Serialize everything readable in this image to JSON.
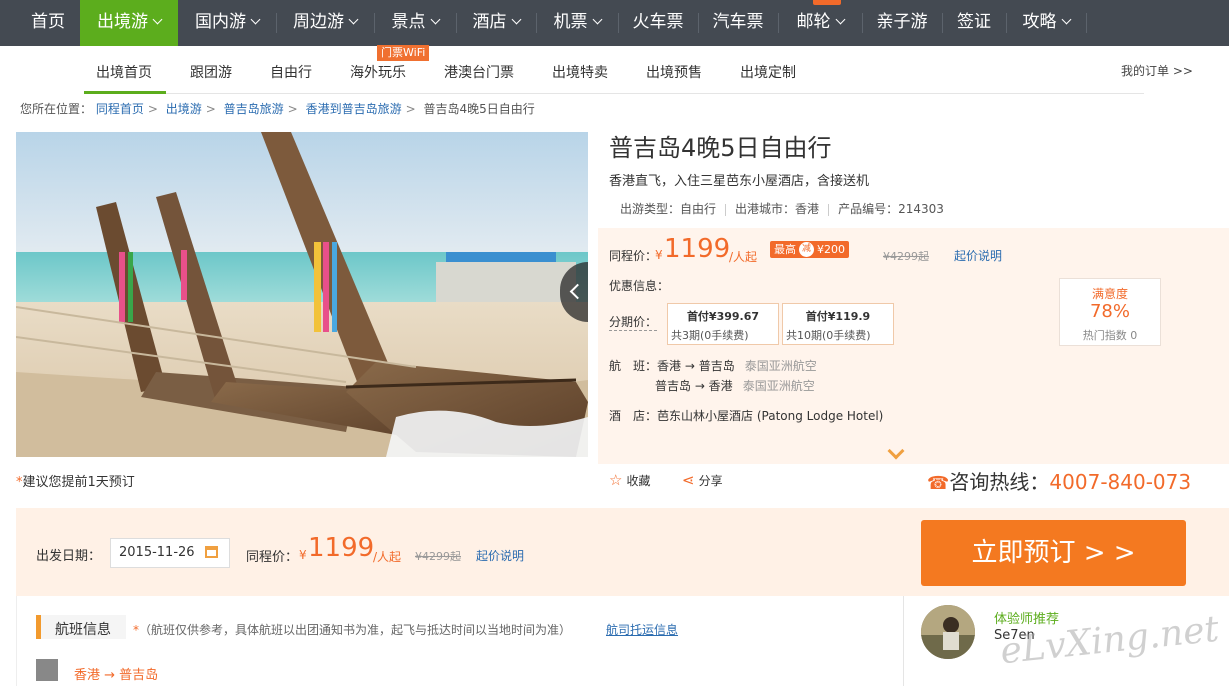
{
  "nav": {
    "items": [
      {
        "label": "首页",
        "dropdown": false
      },
      {
        "label": "出境游",
        "dropdown": true,
        "active": true
      },
      {
        "label": "国内游",
        "dropdown": true
      },
      {
        "label": "周边游",
        "dropdown": true
      },
      {
        "label": "景点",
        "dropdown": true
      },
      {
        "label": "酒店",
        "dropdown": true
      },
      {
        "label": "机票",
        "dropdown": true
      },
      {
        "label": "火车票",
        "dropdown": false
      },
      {
        "label": "汽车票",
        "dropdown": false
      },
      {
        "label": "邮轮",
        "dropdown": true
      },
      {
        "label": "亲子游",
        "dropdown": false
      },
      {
        "label": "签证",
        "dropdown": false
      },
      {
        "label": "攻略",
        "dropdown": true
      }
    ]
  },
  "subnav": {
    "items": [
      "出境首页",
      "跟团游",
      "自由行",
      "海外玩乐",
      "港澳台门票",
      "出境特卖",
      "出境预售",
      "出境定制"
    ],
    "wifi_tag": "门票WiFi",
    "my_orders": "我的订单 >>"
  },
  "breadcrumb": {
    "prefix": "您所在位置：",
    "links": [
      "同程首页",
      "出境游",
      "普吉岛旅游",
      "香港到普吉岛旅游"
    ],
    "current": "普吉岛4晚5日自由行"
  },
  "product": {
    "title": "普吉岛4晚5日自由行",
    "subtitle": "香港直飞，入住三星芭东小屋酒店，含接送机",
    "type_label": "出游类型：",
    "type_value": "自由行",
    "city_label": "出港城市：",
    "city_value": "香港",
    "code_label": "产品编号：",
    "code_value": "214303"
  },
  "pricing": {
    "label": "同程价：",
    "yen": "¥",
    "price": "1199",
    "unit": "/人起",
    "promo_prefix": "最高",
    "promo_circle": "减",
    "promo_amount": "¥200",
    "original": "¥4299起",
    "explain_link": "起价说明",
    "discount_label": "优惠信息：",
    "installment_label": "分期价：",
    "installments": [
      {
        "first": "首付¥399.67",
        "terms": "共3期(0手续费)"
      },
      {
        "first": "首付¥119.9",
        "terms": "共10期(0手续费)"
      }
    ],
    "satisfaction_title": "满意度",
    "satisfaction_value": "78%",
    "popularity": "热门指数 0"
  },
  "flights": {
    "label": "航　班：",
    "legs": [
      {
        "route": "香港 → 普吉岛",
        "airline": "泰国亚洲航空"
      },
      {
        "route": "普吉岛 → 香港",
        "airline": "泰国亚洲航空"
      }
    ],
    "hotel_label": "酒　店：",
    "hotel_value": "芭东山林小屋酒店 (Patong Lodge Hotel)"
  },
  "advice": {
    "star": "*",
    "text_before": "建议您提前",
    "days": "1",
    "text_after": "天预订"
  },
  "actions": {
    "favorite": "收藏",
    "share": "分享"
  },
  "hotline": {
    "label": "咨询热线：",
    "number": "4007-840-073"
  },
  "booking": {
    "date_label": "出发日期：",
    "date_value": "2015-11-26",
    "price_label": "同程价：",
    "yen": "¥",
    "price": "1199",
    "unit": "/人起",
    "original": "¥4299起",
    "explain_link": "起价说明",
    "book_button": "立即预订 > >"
  },
  "flight_section": {
    "tab": "航班信息",
    "note_star": "*",
    "note": "（航班仅供参考，具体航班以出团通知书为准，起飞与抵达时间以当地时间为准）",
    "link": "航司托运信息",
    "route": "香港 → 普吉岛"
  },
  "recommend": {
    "title": "体验师推荐",
    "name": "Se7en"
  },
  "watermark": "eLvXing.net",
  "colors": {
    "nav_bg": "#444a52",
    "nav_active": "#5cad1d",
    "accent_orange": "#f26a2a",
    "button_orange": "#f47920",
    "link_blue": "#2b6cb0",
    "price_box_bg": "#fff4ec"
  }
}
